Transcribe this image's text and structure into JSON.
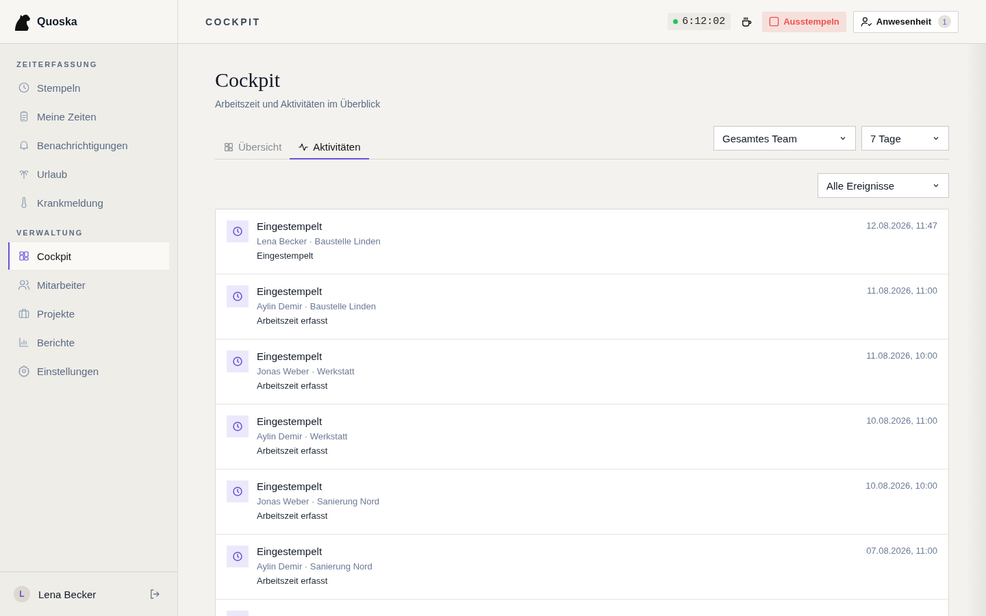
{
  "app": {
    "name": "Quoska"
  },
  "sidebar": {
    "sections": [
      {
        "heading": "ZEITERFASSUNG",
        "items": [
          {
            "label": "Stempeln",
            "selected": false
          },
          {
            "label": "Meine Zeiten",
            "selected": false
          },
          {
            "label": "Benachrichtigungen",
            "selected": false
          },
          {
            "label": "Urlaub",
            "selected": false
          },
          {
            "label": "Krankmeldung",
            "selected": false
          }
        ]
      },
      {
        "heading": "VERWALTUNG",
        "items": [
          {
            "label": "Cockpit",
            "selected": true
          },
          {
            "label": "Mitarbeiter",
            "selected": false
          },
          {
            "label": "Projekte",
            "selected": false
          },
          {
            "label": "Berichte",
            "selected": false
          },
          {
            "label": "Einstellungen",
            "selected": false
          }
        ]
      }
    ]
  },
  "user": {
    "initial": "L",
    "name": "Lena Becker"
  },
  "header": {
    "title": "COCKPIT",
    "timer": {
      "running": true,
      "time": "6:12:02"
    },
    "clock_out": "Ausstempeln",
    "presence": {
      "label": "Anwesenheit",
      "count": "1"
    }
  },
  "page": {
    "title": "Cockpit",
    "subtitle": "Arbeitszeit und Aktivitäten im Überblick"
  },
  "tabs": [
    {
      "label": "Übersicht",
      "selected": false
    },
    {
      "label": "Aktivitäten",
      "selected": true
    }
  ],
  "filters": {
    "team": "Gesamtes Team",
    "range": "7 Tage",
    "events": "Alle Ereignisse"
  },
  "activities": [
    {
      "title": "Eingestempelt",
      "meta": "Lena Becker · Baustelle Linden",
      "detail": "Eingestempelt",
      "time": "12.08.2026, 11:47"
    },
    {
      "title": "Eingestempelt",
      "meta": "Aylin Demir · Baustelle Linden",
      "detail": "Arbeitszeit erfasst",
      "time": "11.08.2026, 11:00"
    },
    {
      "title": "Eingestempelt",
      "meta": "Jonas Weber · Werkstatt",
      "detail": "Arbeitszeit erfasst",
      "time": "11.08.2026, 10:00"
    },
    {
      "title": "Eingestempelt",
      "meta": "Aylin Demir · Werkstatt",
      "detail": "Arbeitszeit erfasst",
      "time": "10.08.2026, 11:00"
    },
    {
      "title": "Eingestempelt",
      "meta": "Jonas Weber · Sanierung Nord",
      "detail": "Arbeitszeit erfasst",
      "time": "10.08.2026, 10:00"
    },
    {
      "title": "Eingestempelt",
      "meta": "Aylin Demir · Sanierung Nord",
      "detail": "Arbeitszeit erfasst",
      "time": "07.08.2026, 11:00"
    }
  ]
}
